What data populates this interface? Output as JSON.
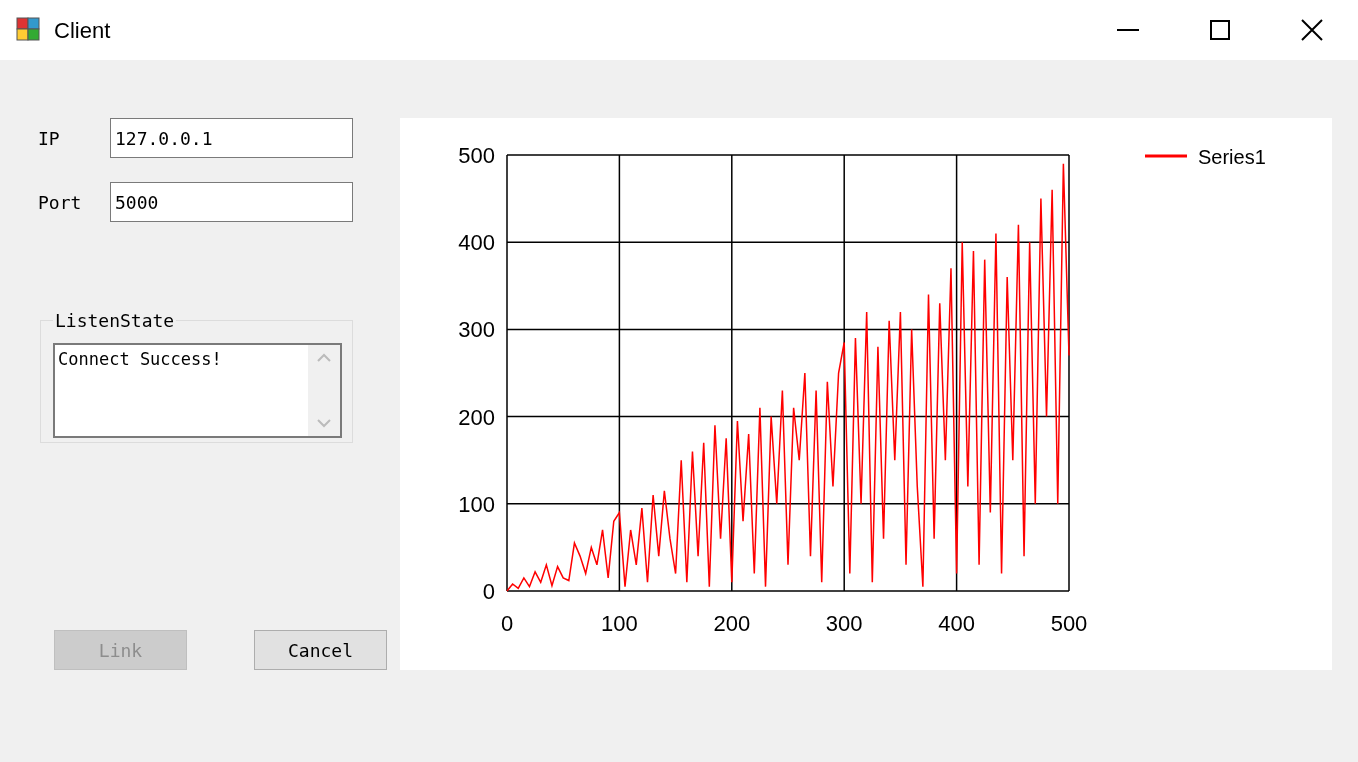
{
  "window": {
    "title": "Client"
  },
  "fields": [
    {
      "label": "IP",
      "value": "127.0.0.1"
    },
    {
      "label": "Port",
      "value": "5000"
    }
  ],
  "listen_state": {
    "title": "ListenState",
    "text": "Connect Success!"
  },
  "buttons": [
    {
      "label": "Link",
      "disabled": true
    },
    {
      "label": "Cancel",
      "disabled": false
    }
  ],
  "chart": {
    "chart_data": {
      "type": "line",
      "x": [
        0,
        5,
        10,
        15,
        20,
        25,
        30,
        35,
        40,
        45,
        50,
        55,
        60,
        65,
        70,
        75,
        80,
        85,
        90,
        95,
        100,
        105,
        110,
        115,
        120,
        125,
        130,
        135,
        140,
        145,
        150,
        155,
        160,
        165,
        170,
        175,
        180,
        185,
        190,
        195,
        200,
        205,
        210,
        215,
        220,
        225,
        230,
        235,
        240,
        245,
        250,
        255,
        260,
        265,
        270,
        275,
        280,
        285,
        290,
        295,
        300,
        305,
        310,
        315,
        320,
        325,
        330,
        335,
        340,
        345,
        350,
        355,
        360,
        365,
        370,
        375,
        380,
        385,
        390,
        395,
        400,
        405,
        410,
        415,
        420,
        425,
        430,
        435,
        440,
        445,
        450,
        455,
        460,
        465,
        470,
        475,
        480,
        485,
        490,
        495,
        500
      ],
      "series": [
        {
          "name": "Series1",
          "color": "#ff0000",
          "values": [
            0,
            8,
            3,
            15,
            5,
            22,
            10,
            30,
            6,
            28,
            15,
            12,
            55,
            40,
            20,
            50,
            30,
            70,
            15,
            80,
            90,
            5,
            70,
            30,
            95,
            10,
            110,
            40,
            115,
            60,
            20,
            150,
            10,
            160,
            40,
            170,
            5,
            190,
            60,
            175,
            10,
            195,
            80,
            180,
            20,
            210,
            5,
            200,
            100,
            230,
            30,
            210,
            150,
            250,
            40,
            230,
            10,
            240,
            120,
            250,
            285,
            20,
            290,
            100,
            320,
            10,
            280,
            60,
            310,
            150,
            320,
            30,
            300,
            120,
            5,
            340,
            60,
            330,
            150,
            370,
            20,
            400,
            120,
            390,
            30,
            380,
            90,
            410,
            20,
            360,
            150,
            420,
            40,
            400,
            100,
            450,
            200,
            460,
            100,
            490,
            270
          ]
        }
      ],
      "grid": true,
      "xlim": [
        0,
        500
      ],
      "ylim": [
        0,
        500
      ],
      "xticks": [
        0,
        100,
        200,
        300,
        400,
        500
      ],
      "yticks": [
        0,
        100,
        200,
        300,
        400,
        500
      ]
    }
  }
}
